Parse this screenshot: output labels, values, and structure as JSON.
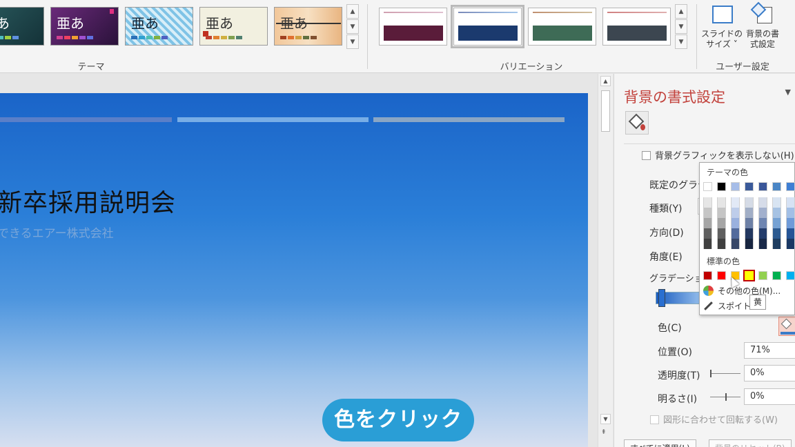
{
  "ribbon": {
    "themes_label": "テーマ",
    "variations_label": "バリエーション",
    "user_group_label": "ユーザー設定",
    "theme_sample": "亜あ",
    "slide_size_line1": "スライドの",
    "slide_size_line2": "サイズ ˅",
    "format_bg_line1": "背景の書",
    "format_bg_line2": "式設定"
  },
  "slide": {
    "title": "新卒採用説明会",
    "subtitle": "できるエアー株式会社"
  },
  "callout": "色をクリック",
  "pane": {
    "title": "背景の書式設定",
    "hide_bg_graphics": "背景グラフィックを表示しない(H)",
    "preset_gradient": "既定のグラデ",
    "type": "種類(Y)",
    "direction": "方向(D)",
    "angle": "角度(E)",
    "gradient_stops": "グラデーション",
    "color": "色(C)",
    "position": "位置(O)",
    "position_value": "71%",
    "transparency": "透明度(T)",
    "transparency_value": "0%",
    "brightness": "明るさ(I)",
    "brightness_value": "0%",
    "rotate_with_shape": "図形に合わせて回転する(W)",
    "apply_all": "すべてに適用(L)",
    "reset_bg": "背景のリセット(B)"
  },
  "palette": {
    "theme_colors_label": "テーマの色",
    "standard_colors_label": "標準の色",
    "more_colors": "その他の色(M)...",
    "eyedropper": "スポイト",
    "tooltip": "黄",
    "theme_top_row": [
      "#ffffff",
      "#000000",
      "#a6bde8",
      "#3a5a9a",
      "#3a5699",
      "#4a86c6",
      "#3f7fd4"
    ],
    "standard_colors": [
      "#c00000",
      "#ff0000",
      "#ffc000",
      "#ffff00",
      "#92d050",
      "#00b050",
      "#00b0f0"
    ],
    "selected_color": "#ffff00",
    "selection_border": "#c00000"
  },
  "colors": {
    "pane_title": "#c2413b",
    "callout_bg": "#2a9ed6",
    "slide_top": "#1a64c8"
  }
}
